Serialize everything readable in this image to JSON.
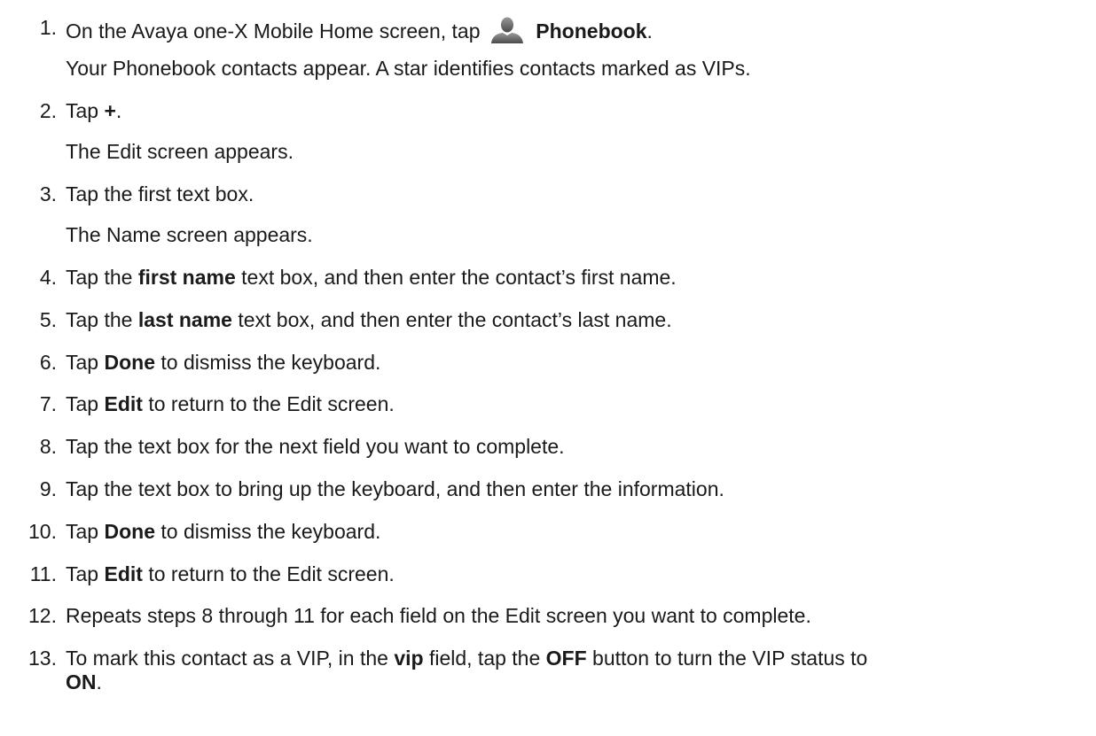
{
  "steps": [
    {
      "n": "1.",
      "segs": [
        {
          "t": "On the Avaya one-X Mobile Home screen, tap "
        },
        {
          "icon": "person-icon"
        },
        {
          "t": " "
        },
        {
          "t": "Phonebook",
          "b": true
        },
        {
          "t": "."
        }
      ],
      "note": "Your Phonebook contacts appear. A star identifies contacts marked as VIPs."
    },
    {
      "n": "2.",
      "segs": [
        {
          "t": "Tap "
        },
        {
          "t": "+",
          "b": true
        },
        {
          "t": "."
        }
      ],
      "note": "The Edit screen appears."
    },
    {
      "n": "3.",
      "segs": [
        {
          "t": "Tap the first text box."
        }
      ],
      "note": "The Name screen appears."
    },
    {
      "n": "4.",
      "segs": [
        {
          "t": "Tap the "
        },
        {
          "t": "first name",
          "b": true
        },
        {
          "t": " text box, and then enter the contact’s first name."
        }
      ]
    },
    {
      "n": "5.",
      "segs": [
        {
          "t": "Tap the "
        },
        {
          "t": "last name",
          "b": true
        },
        {
          "t": " text box, and then enter the contact’s last name."
        }
      ]
    },
    {
      "n": "6.",
      "segs": [
        {
          "t": "Tap "
        },
        {
          "t": "Done",
          "b": true
        },
        {
          "t": " to dismiss the keyboard."
        }
      ]
    },
    {
      "n": "7.",
      "segs": [
        {
          "t": "Tap "
        },
        {
          "t": "Edit",
          "b": true
        },
        {
          "t": " to return to the Edit screen."
        }
      ]
    },
    {
      "n": "8.",
      "segs": [
        {
          "t": "Tap the text box for the next field you want to complete."
        }
      ]
    },
    {
      "n": "9.",
      "segs": [
        {
          "t": "Tap the text box to bring up the keyboard, and then enter the information."
        }
      ]
    },
    {
      "n": "10.",
      "segs": [
        {
          "t": "Tap "
        },
        {
          "t": "Done",
          "b": true
        },
        {
          "t": " to dismiss the keyboard."
        }
      ]
    },
    {
      "n": "11.",
      "segs": [
        {
          "t": "Tap "
        },
        {
          "t": "Edit",
          "b": true
        },
        {
          "t": " to return to the Edit screen."
        }
      ]
    },
    {
      "n": "12.",
      "segs": [
        {
          "t": "Repeats steps 8 through 11 for each field on the Edit screen you want to complete."
        }
      ]
    },
    {
      "n": "13.",
      "segs": [
        {
          "t": "To mark this contact as a VIP, in the "
        },
        {
          "t": "vip",
          "b": true
        },
        {
          "t": " field, tap the "
        },
        {
          "t": "OFF",
          "b": true
        },
        {
          "t": " button to turn the VIP status to"
        }
      ],
      "cont": [
        {
          "t": "ON",
          "b": true
        },
        {
          "t": "."
        }
      ]
    }
  ]
}
